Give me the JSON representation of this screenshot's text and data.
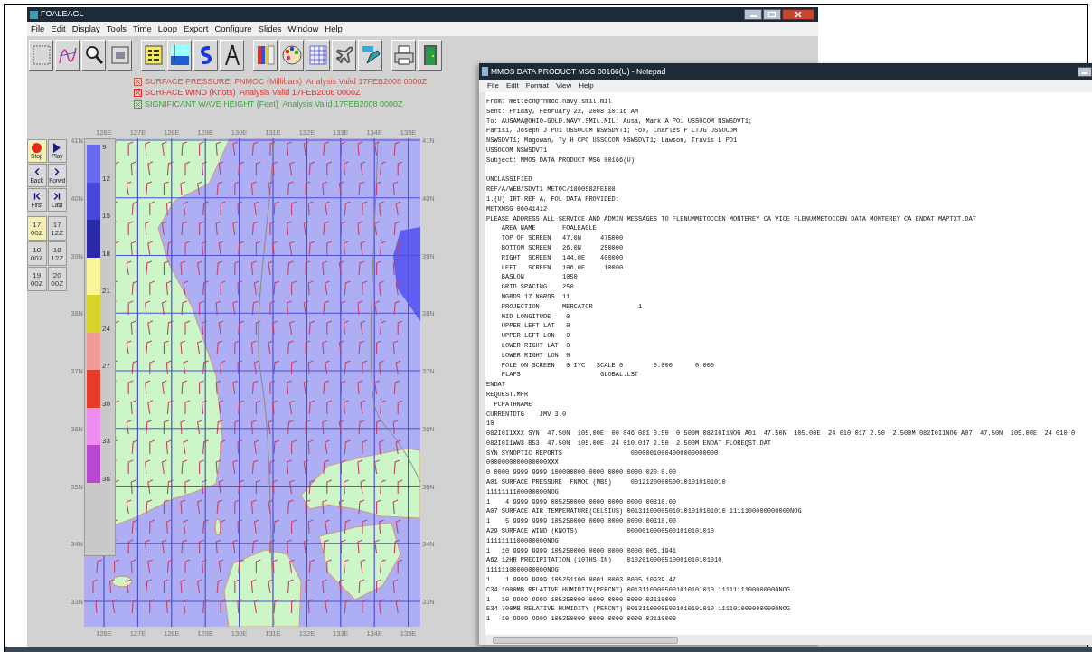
{
  "main_window": {
    "title": "FOALEAGL",
    "menu": [
      "File",
      "Edit",
      "Display",
      "Tools",
      "Time",
      "Loop",
      "Export",
      "Configure",
      "Slides",
      "Window",
      "Help"
    ],
    "layers": [
      {
        "text": "SURFACE PRESSURE  FNMOC (Millibars)  Analysis Valid 17FEB2008 0000Z",
        "color": "#c0584c"
      },
      {
        "text": "SURFACE WIND (Knots)  Analysis Valid 17FEB2008 0000Z",
        "color": "#e0302c"
      },
      {
        "text": "SIGNIFICANT WAVE HEIGHT (Feet)  Analysis Valid 17FEB2008 0000Z",
        "color": "#3fa43f"
      }
    ],
    "playback_controls": [
      {
        "label": "Stop",
        "kind": "stop",
        "selected": true
      },
      {
        "label": "Play",
        "kind": "play",
        "selected": false
      },
      {
        "label": "Back",
        "kind": "back",
        "selected": false
      },
      {
        "label": "Forwd",
        "kind": "forward",
        "selected": false
      },
      {
        "label": "First",
        "kind": "first",
        "selected": false
      },
      {
        "label": "Last",
        "kind": "last",
        "selected": false
      }
    ],
    "time_steps": [
      {
        "day": "17",
        "hour": "00Z",
        "selected": true
      },
      {
        "day": "17",
        "hour": "12Z",
        "selected": false
      },
      {
        "day": "18",
        "hour": "00Z",
        "selected": false
      },
      {
        "day": "18",
        "hour": "12Z",
        "selected": false
      },
      {
        "day": "19",
        "hour": "00Z",
        "selected": false
      },
      {
        "day": "20",
        "hour": "00Z",
        "selected": false
      }
    ],
    "map": {
      "top_longitudes": [
        "126E",
        "127E",
        "128E",
        "129E",
        "130E",
        "131E",
        "132E",
        "133E",
        "134E",
        "135E"
      ],
      "bottom_longitudes": [
        "126E",
        "127E",
        "128E",
        "129E",
        "130E",
        "131E",
        "132E",
        "133E",
        "134E",
        "135E"
      ],
      "left_latitudes": [
        "41N",
        "40N",
        "39N",
        "38N",
        "37N",
        "36N",
        "35N",
        "34N",
        "33N"
      ],
      "right_latitudes": [
        "41N",
        "40N",
        "39N",
        "38N",
        "37N",
        "36N",
        "35N",
        "34N",
        "33N"
      ]
    },
    "color_scale": {
      "bands": [
        {
          "color": "#6868f0"
        },
        {
          "color": "#4646d8"
        },
        {
          "color": "#2a2aa8"
        },
        {
          "color": "#fbf59a"
        },
        {
          "color": "#d8d42a"
        },
        {
          "color": "#f09a9a"
        },
        {
          "color": "#e83a28"
        },
        {
          "color": "#ee8cf0"
        },
        {
          "color": "#b848d0"
        }
      ],
      "labels": [
        "9",
        "12",
        "15",
        "18",
        "21",
        "24",
        "27",
        "30",
        "33",
        "36"
      ]
    }
  },
  "notepad": {
    "title": "MMOS DATA PRODUCT MSG 00166(U) - Notepad",
    "menu": [
      "File",
      "Edit",
      "Format",
      "View",
      "Help"
    ],
    "header_lines": [
      "From: mettech@fnmoc.navy.smil.mil",
      "Sent: Friday, February 22, 2008 10:16 AM",
      "To: AUSAMA@OHIO-GOLD.NAVY.SMIL.MIL; Ausa, Mark A PO1 USSOCOM NSWSDVT1;",
      "Parisi, Joseph J PO1 USSOCOM NSWSDVT1; Fox, Charles P LTJG USSOCOM",
      "NSWSDVT1; Magowan, Ty H CPO USSOCOM NSWSDVT1; Lawson, Travis L PO1",
      "USSOCOM NSWSDVT1",
      "Subject: MMOS DATA PRODUCT MSG 00166(U)"
    ],
    "body_lines": [
      "UNCLASSIFIED",
      "REF/A/WEB/SDVT1 METOC/1800582FE808",
      "1.(U) IRT REF A, FOL DATA PROVIDED:",
      "METXMSG 06041412",
      "PLEASE ADDRESS ALL SERVICE AND ADMIN MESSAGES TO FLENUMMETOCCEN MONTEREY CA VICE FLENUMMETOCCEN DATA MONTEREY CA ENDAT MAPTXT.DAT",
      "    AREA NAME       FOALEAGLE",
      "    TOP OF SCREEN   47.0N     475000",
      "    BOTTOM SCREEN   26.0N     250000",
      "    RIGHT  SCREEN   144.0E    400000",
      "    LEFT   SCREEN   106.0E     10000",
      "    BASLON          1050",
      "    GRID SPACING    250",
      "    MGRDS 17 NGRDS  11",
      "    PROJECTION      MERCATOR            1",
      "    MID LONGITUDE    0",
      "    UPPER LEFT LAT   0",
      "    UPPER LEFT LON   0",
      "    LOWER RIGHT LAT  0",
      "    LOWER RIGHT LON  0",
      "    POLE ON SCREEN   0 IYC   SCALE 0        0.000      0.000",
      "    FLAPS                     GLOBAL.LST",
      "ENDAT",
      "REQUEST.MFR",
      "  PCPATHNAME",
      "CURRENTDTG    JMV 3.0",
      "10",
      "082I0I1XXX SYN  47.50N  105.00E  00 046 081 0.50  0.500M 082I0I1NOG A01  47.50N  105.00E  24 010 017 2.50  2.500M 082I0I1NOG A07  47.50N  105.00E  24 010 0",
      "082I0I1WW3 B53  47.50N  105.00E  24 010 017 2.50  2.500M ENDAT FLOREQST.DAT",
      "SYN SYNOPTIC REPORTS                  00000010004000000000000",
      "0000000000000000XXX",
      "0 0000 9999 9999 100000000 0000 0000 0000 020 0.00",
      "A01 SURFACE PRESSURE  FNMOC (MBS)     0012120000500101010101010",
      "1111111100000000NOG",
      "1    4 9999 9999 005250000 0000 0000 0000 00810.00",
      "A07 SURFACE AIR TEMPERATURE(CELSIUS) 00131100005010101010101010 1111100000000000NOG",
      "1    5 9999 9999 105250000 0000 0000 0000 00310.00",
      "A29 SURFACE WIND (KNOTS)             00000100005001010101010",
      "1111111100000000NOG",
      "1   10 9999 9999 105250000 0000 0000 0000 006.1941",
      "A62 12HR PRECIPITATION (10THS IN)    0102010000510001010101010",
      "1111110000000000NOG",
      "1    1 9999 9999 105251100 0001 0003 0005 10939.47",
      "C34 1000MB RELATIVE HUMIDITY(PERCNT) 00131100005001010101010 1111111100000000NOG",
      "1   10 9999 9999 105250000 0000 0000 0000 02110000",
      "E34 700MB RELATIVE HUMIDITY (PERCNT) 00131100005001010101010 1111010000000000NOG",
      "1   10 9999 9999 105250000 0000 0000 0000 02110000"
    ]
  }
}
